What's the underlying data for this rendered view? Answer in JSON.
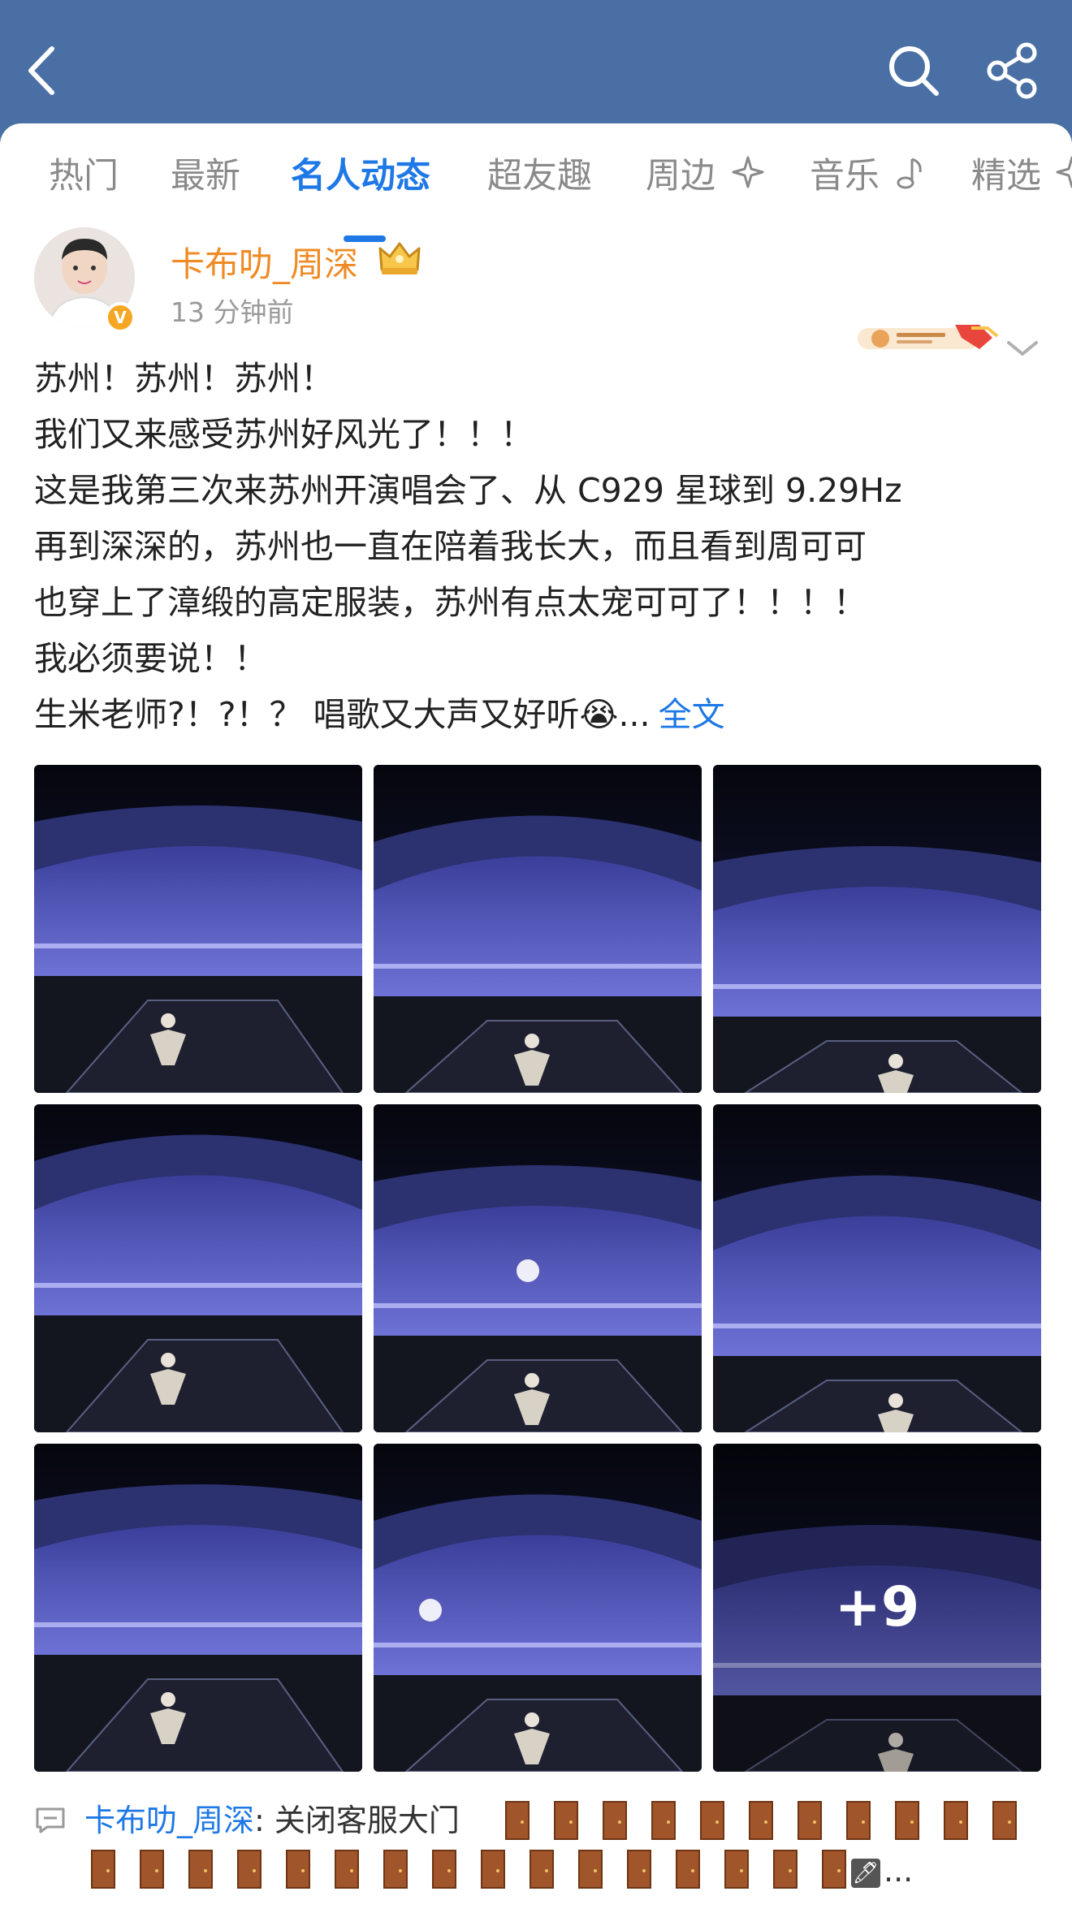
{
  "nav": {
    "back_icon": "chevron-left-icon",
    "title": "",
    "search_icon": "search-icon",
    "share_icon": "share-icon"
  },
  "tabs": [
    {
      "label": "热门",
      "active": false
    },
    {
      "label": "最新",
      "active": false
    },
    {
      "label": "名人动态",
      "active": true
    },
    {
      "label": "超友趣",
      "active": false
    },
    {
      "label": "周边",
      "active": false
    },
    {
      "label": "音乐",
      "active": false
    },
    {
      "label": "精选",
      "active": false
    }
  ],
  "post": {
    "author": "卡布叻_周深",
    "verified_badge": "V",
    "time": "13 分钟前",
    "text_lines": [
      "苏州！苏州！苏州！",
      "我们又来感受苏州好风光了！！！",
      "这是我第三次来苏州开演唱会了、从 C929 星球到 9.29Hz",
      "再到深深的，苏州也一直在陪着我长大，而且看到周可可",
      "也穿上了漳缎的高定服装，苏州有点太宠可可了！！！！",
      "我必须要说！！",
      "生米老师?！?！？ 唱歌又大声又好听😭"
    ],
    "ellipsis": "...",
    "full_text_link": "全文",
    "image_count": 9,
    "more_images": "+9"
  },
  "comment": {
    "user": "卡布叻_周深",
    "text": ": 关闭客服大门",
    "edit_badge": "🖊",
    "tail": "..."
  },
  "colors": {
    "header_bg": "#4a6fa5",
    "accent": "#1e78e6",
    "author": "#f08a24"
  }
}
